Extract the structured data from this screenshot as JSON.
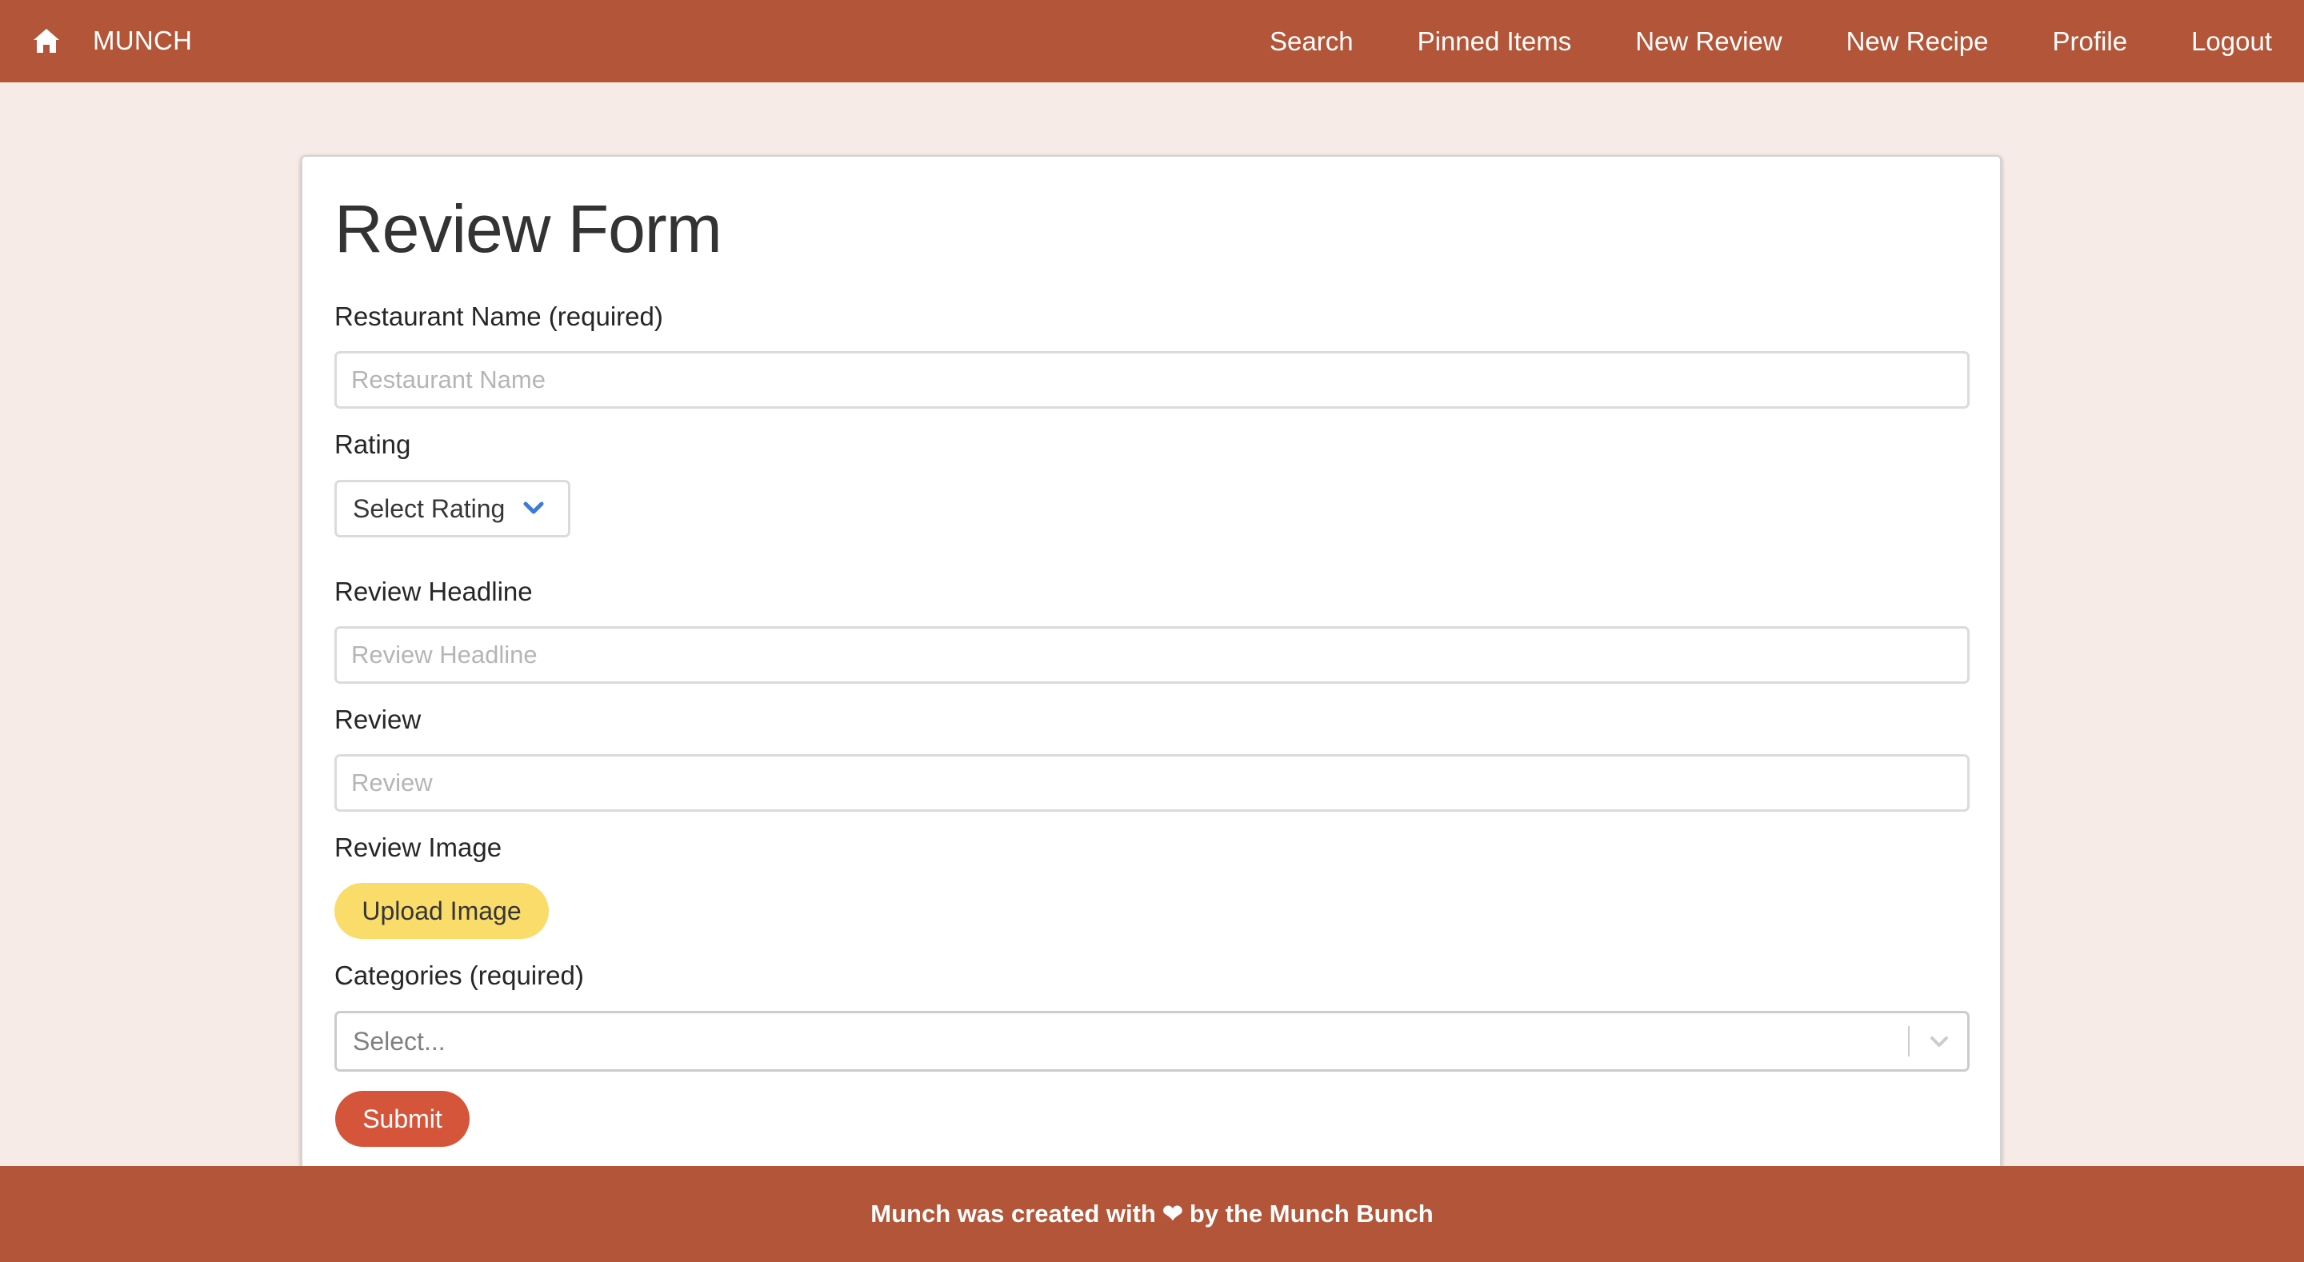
{
  "navbar": {
    "brand": "MUNCH",
    "home_icon": "home-icon",
    "links": [
      "Search",
      "Pinned Items",
      "New Review",
      "New Recipe",
      "Profile",
      "Logout"
    ]
  },
  "form": {
    "title": "Review Form",
    "restaurant": {
      "label": "Restaurant Name (required)",
      "placeholder": "Restaurant Name",
      "value": ""
    },
    "rating": {
      "label": "Rating",
      "selected": "Select Rating"
    },
    "headline": {
      "label": "Review Headline",
      "placeholder": "Review Headline",
      "value": ""
    },
    "review": {
      "label": "Review",
      "placeholder": "Review",
      "value": ""
    },
    "image": {
      "label": "Review Image",
      "button": "Upload Image"
    },
    "categories": {
      "label": "Categories (required)",
      "placeholder": "Select..."
    },
    "submit": "Submit"
  },
  "footer": {
    "prefix": "Munch was created with",
    "heart": "❤",
    "suffix": "by the Munch Bunch"
  },
  "colors": {
    "brand": "#b35538",
    "background": "#f7ebe8",
    "upload_button": "#fadc6b",
    "submit_button": "#d4553a",
    "chevron": "#3e7bd6"
  }
}
